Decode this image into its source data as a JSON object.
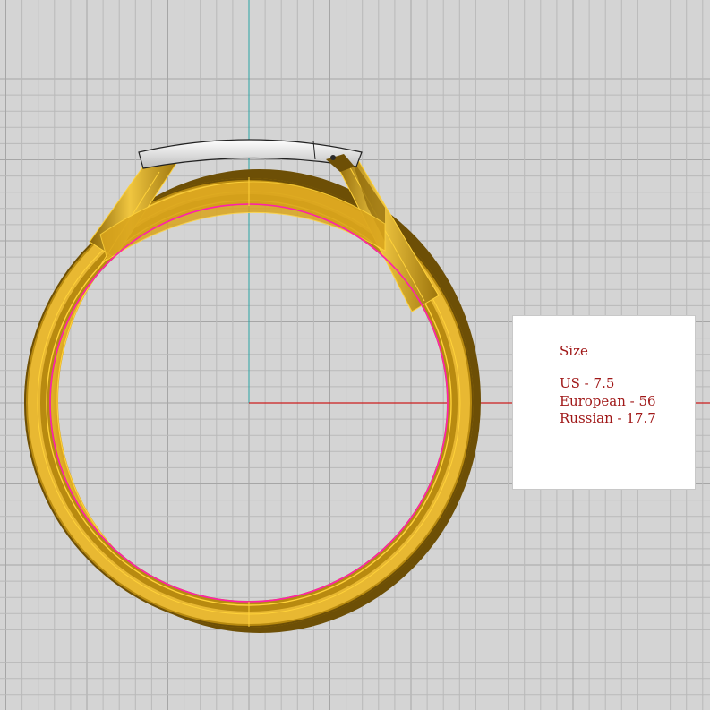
{
  "viewport": {
    "name": "top-view",
    "colors": {
      "background": "#d4d4d4",
      "grid_minor": "#b9b9b9",
      "grid_major": "#a6a6a6",
      "axis_x": "#cc1f1f",
      "axis_y": "#2aa3a3",
      "gold": "#d9a41c",
      "gold_edge": "#ffd23a",
      "gold_dark": "#7a5a08",
      "inner_circle": "#ff1fae",
      "metal_plate": "#eeeeee"
    }
  },
  "size_panel": {
    "title": "Size",
    "us": "US - 7.5",
    "european": "European - 56",
    "russian": "Russian - 17.7",
    "text_color": "#a01818"
  }
}
